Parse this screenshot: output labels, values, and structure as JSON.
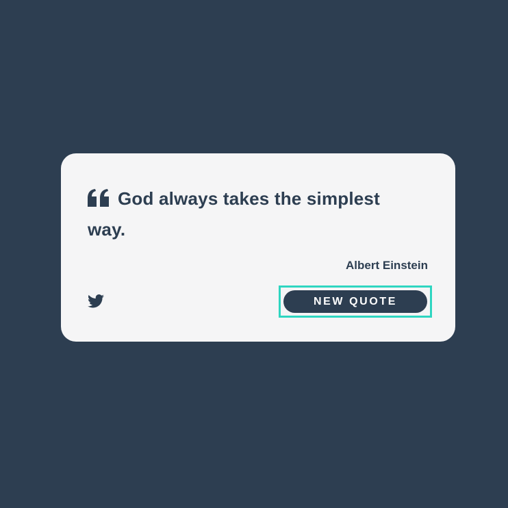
{
  "quote": {
    "text": "God always takes the simplest way.",
    "author": "Albert Einstein"
  },
  "actions": {
    "new_quote_label": "NEW QUOTE",
    "tweet_icon": "twitter-icon"
  },
  "colors": {
    "background": "#2d3e51",
    "card": "#f5f5f6",
    "text": "#2d3e51",
    "focus_ring": "#2fd6c1",
    "button_text": "#ffffff"
  }
}
